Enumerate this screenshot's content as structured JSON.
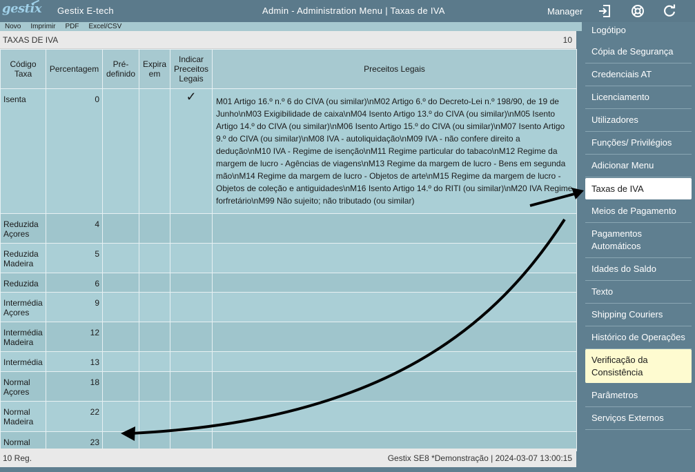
{
  "header": {
    "logo_text": "gestix",
    "app_name": "Gestix E-tech",
    "title": "Admin - Administration Menu | Taxas de IVA",
    "user": "Manager"
  },
  "top_icons": [
    "logout-icon",
    "lifebuoy-icon",
    "refresh-icon"
  ],
  "menubar": [
    "Novo",
    "Imprimir",
    "PDF",
    "Excel/CSV"
  ],
  "panel": {
    "title": "TAXAS DE IVA",
    "count": "10"
  },
  "table": {
    "columns": [
      "Código Taxa",
      "Percentagem",
      "Pré-definido",
      "Expira em",
      "Indicar Preceitos Legais",
      "Preceitos Legais"
    ],
    "rows": [
      {
        "code": "Isenta",
        "percent": "0",
        "predefined": "",
        "expires": "",
        "indicate": true,
        "legal": "M01 Artigo 16.º n.º 6 do CIVA (ou similar)\\nM02 Artigo 6.º do Decreto-Lei n.º 198/90, de 19 de Junho\\nM03 Exigibilidade de caixa\\nM04 Isento Artigo 13.º do CIVA (ou similar)\\nM05 Isento Artigo 14.º do CIVA (ou similar)\\nM06 Isento Artigo 15.º do CIVA (ou similar)\\nM07 Isento Artigo 9.º do CIVA (ou similar)\\nM08 IVA - autoliquidação\\nM09 IVA - não confere direito a dedução\\nM10 IVA - Regime de isenção\\nM11 Regime particular do tabaco\\nM12 Regime da margem de lucro - Agências de viagens\\nM13 Regime da margem de lucro - Bens em segunda mão\\nM14 Regime da margem de lucro - Objetos de arte\\nM15 Regime da margem de lucro - Objetos de coleção e antiguidades\\nM16 Isento Artigo 14.º do RITI (ou similar)\\nM20 IVA Regime forfretário\\nM99 Não sujeito; não tributado (ou similar)"
      },
      {
        "code": "Reduzida Açores",
        "percent": "4",
        "predefined": "",
        "expires": "",
        "indicate": false,
        "legal": ""
      },
      {
        "code": "Reduzida Madeira",
        "percent": "5",
        "predefined": "",
        "expires": "",
        "indicate": false,
        "legal": ""
      },
      {
        "code": "Reduzida",
        "percent": "6",
        "predefined": "",
        "expires": "",
        "indicate": false,
        "legal": ""
      },
      {
        "code": "Intermédia Açores",
        "percent": "9",
        "predefined": "",
        "expires": "",
        "indicate": false,
        "legal": ""
      },
      {
        "code": "Intermédia Madeira",
        "percent": "12",
        "predefined": "",
        "expires": "",
        "indicate": false,
        "legal": ""
      },
      {
        "code": "Intermédia",
        "percent": "13",
        "predefined": "",
        "expires": "",
        "indicate": false,
        "legal": ""
      },
      {
        "code": "Normal Açores",
        "percent": "18",
        "predefined": "",
        "expires": "",
        "indicate": false,
        "legal": ""
      },
      {
        "code": "Normal Madeira",
        "percent": "22",
        "predefined": "",
        "expires": "",
        "indicate": false,
        "legal": ""
      },
      {
        "code": "Normal",
        "percent": "23",
        "predefined": "",
        "expires": "",
        "indicate": false,
        "legal": ""
      }
    ]
  },
  "footer": {
    "records": "10 Reg.",
    "info": "Gestix SE8 *Demonstração | 2024-03-07 13:00:15"
  },
  "sidebar": {
    "items": [
      {
        "label": "Logótipo",
        "state": ""
      },
      {
        "label": "Cópia de Segurança",
        "state": ""
      },
      {
        "label": "Credenciais AT",
        "state": ""
      },
      {
        "label": "Licenciamento",
        "state": ""
      },
      {
        "label": "Utilizadores",
        "state": ""
      },
      {
        "label": "Funções/ Privilégios",
        "state": ""
      },
      {
        "label": "Adicionar Menu",
        "state": ""
      },
      {
        "label": "Taxas de IVA",
        "state": "active"
      },
      {
        "label": "Meios de Pagamento",
        "state": ""
      },
      {
        "label": "Pagamentos Automáticos",
        "state": ""
      },
      {
        "label": "Idades do Saldo",
        "state": ""
      },
      {
        "label": "Texto",
        "state": ""
      },
      {
        "label": "Shipping Couriers",
        "state": ""
      },
      {
        "label": "Histórico de Operações",
        "state": ""
      },
      {
        "label": "Verificação da Consistência",
        "state": "highlight"
      },
      {
        "label": "Parâmetros",
        "state": ""
      },
      {
        "label": "Serviços Externos",
        "state": ""
      }
    ]
  },
  "colors": {
    "topbar": "#5b7a8b",
    "sidebar": "#5f7f90",
    "table_bg": "#aacfd6",
    "active_item": "#ffffff",
    "highlight_item": "#fefbd0"
  }
}
